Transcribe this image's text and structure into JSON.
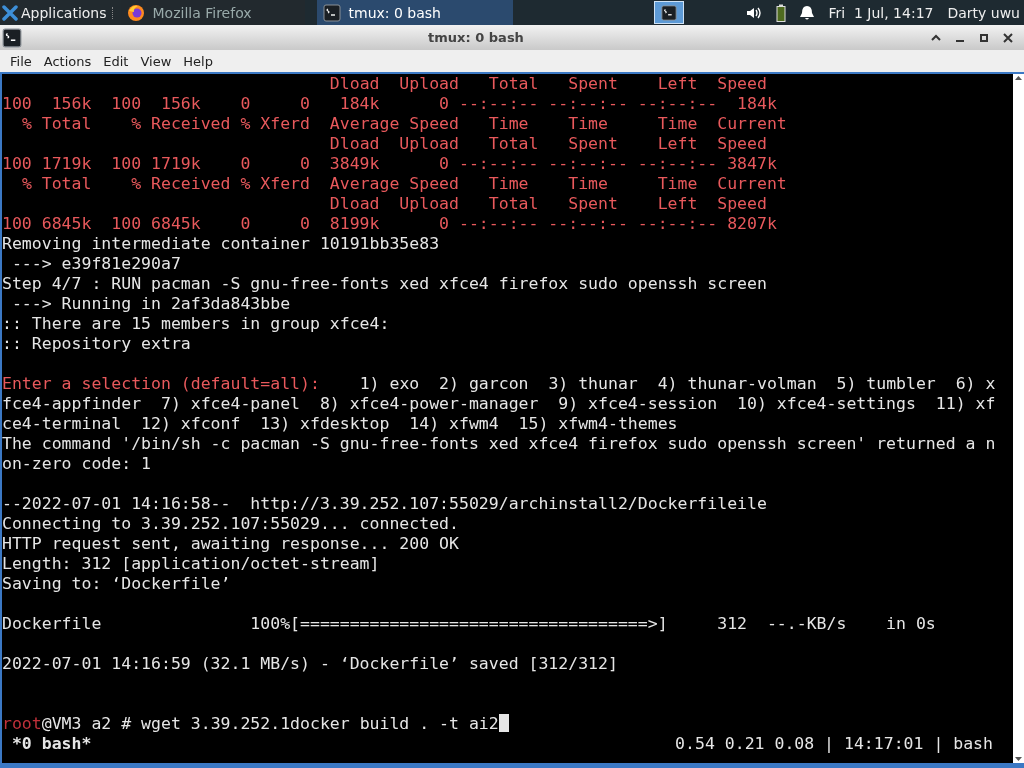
{
  "panel": {
    "apps_label": "Applications",
    "tasks": [
      {
        "label": "Mozilla Firefox",
        "selected": false
      },
      {
        "label": "tmux: 0 bash",
        "selected": true
      }
    ],
    "clock": "Fri  1 Jul, 14:17",
    "user": "Darty uwu"
  },
  "window": {
    "title": "tmux: 0 bash"
  },
  "menu": [
    "File",
    "Actions",
    "Edit",
    "View",
    "Help"
  ],
  "terminal": {
    "lines": [
      {
        "spans": [
          {
            "text": "                                 Dload  Upload   Total   Spent    Left  Speed",
            "color": "#e8595c"
          }
        ]
      },
      {
        "spans": [
          {
            "text": "100  156k  100  156k    0     0   184k      0 --:--:-- --:--:-- --:--:--  184k",
            "color": "#e8595c"
          }
        ]
      },
      {
        "spans": [
          {
            "text": "  % Total    % Received % Xferd  Average Speed   Time    Time     Time  Current",
            "color": "#e8595c"
          }
        ]
      },
      {
        "spans": [
          {
            "text": "                                 Dload  Upload   Total   Spent    Left  Speed",
            "color": "#e8595c"
          }
        ]
      },
      {
        "spans": [
          {
            "text": "100 1719k  100 1719k    0     0  3849k      0 --:--:-- --:--:-- --:--:-- 3847k",
            "color": "#e8595c"
          }
        ]
      },
      {
        "spans": [
          {
            "text": "  % Total    % Received % Xferd  Average Speed   Time    Time     Time  Current",
            "color": "#e8595c"
          }
        ]
      },
      {
        "spans": [
          {
            "text": "                                 Dload  Upload   Total   Spent    Left  Speed",
            "color": "#e8595c"
          }
        ]
      },
      {
        "spans": [
          {
            "text": "100 6845k  100 6845k    0     0  8199k      0 --:--:-- --:--:-- --:--:-- 8207k",
            "color": "#e8595c"
          }
        ]
      },
      {
        "spans": [
          {
            "text": "Removing intermediate container 10191bb35e83",
            "color": "#e6e6e6"
          }
        ]
      },
      {
        "spans": [
          {
            "text": " ---> e39f81e290a7",
            "color": "#e6e6e6"
          }
        ]
      },
      {
        "spans": [
          {
            "text": "Step 4/7 : RUN pacman -S gnu-free-fonts xed xfce4 firefox sudo openssh screen",
            "color": "#e6e6e6"
          }
        ]
      },
      {
        "spans": [
          {
            "text": " ---> Running in 2af3da843bbe",
            "color": "#e6e6e6"
          }
        ]
      },
      {
        "spans": [
          {
            "text": ":: There are 15 members in group xfce4:",
            "color": "#e6e6e6"
          }
        ]
      },
      {
        "spans": [
          {
            "text": ":: Repository extra",
            "color": "#e6e6e6"
          }
        ]
      },
      {
        "kind": "blank"
      },
      {
        "spans": [
          {
            "text": "Enter a selection (default=all):",
            "color": "#e8595c"
          },
          {
            "text": "    1) exo  2) garcon  3) thunar  4) thunar-volman  5) tumbler  6) x",
            "color": "#e6e6e6"
          }
        ]
      },
      {
        "spans": [
          {
            "text": "fce4-appfinder  7) xfce4-panel  8) xfce4-power-manager  9) xfce4-session  10) xfce4-settings  11) xf",
            "color": "#e6e6e6"
          }
        ]
      },
      {
        "spans": [
          {
            "text": "ce4-terminal  12) xfconf  13) xfdesktop  14) xfwm4  15) xfwm4-themes",
            "color": "#e6e6e6"
          }
        ]
      },
      {
        "spans": [
          {
            "text": "The command '/bin/sh -c pacman -S gnu-free-fonts xed xfce4 firefox sudo openssh screen' returned a n",
            "color": "#e6e6e6"
          }
        ]
      },
      {
        "spans": [
          {
            "text": "on-zero code: 1",
            "color": "#e6e6e6"
          }
        ]
      },
      {
        "kind": "blank"
      },
      {
        "spans": [
          {
            "text": "--2022-07-01 14:16:58--  http://3.39.252.107:55029/archinstall2/Dockerfileile",
            "color": "#e6e6e6"
          }
        ]
      },
      {
        "spans": [
          {
            "text": "Connecting to 3.39.252.107:55029... connected.",
            "color": "#e6e6e6"
          }
        ]
      },
      {
        "spans": [
          {
            "text": "HTTP request sent, awaiting response... 200 OK",
            "color": "#e6e6e6"
          }
        ]
      },
      {
        "spans": [
          {
            "text": "Length: 312 [application/octet-stream]",
            "color": "#e6e6e6"
          }
        ]
      },
      {
        "spans": [
          {
            "text": "Saving to: ‘Dockerfile’",
            "color": "#e6e6e6"
          }
        ]
      },
      {
        "kind": "blank"
      },
      {
        "spans": [
          {
            "text": "Dockerfile               100%[===================================>]     312  --.-KB/s    in 0s",
            "color": "#e6e6e6"
          }
        ]
      },
      {
        "kind": "blank"
      },
      {
        "spans": [
          {
            "text": "2022-07-01 14:16:59 (32.1 MB/s) - ‘Dockerfile’ saved [312/312]",
            "color": "#e6e6e6"
          }
        ]
      },
      {
        "kind": "blank"
      },
      {
        "kind": "blank"
      }
    ],
    "prompt": {
      "spans": [
        {
          "text": "root",
          "color": "#c0303a"
        },
        {
          "text": "@VM3 a2 # wget 3.39.252.1docker build . -t ai2",
          "color": "#e6e6e6"
        }
      ],
      "cursor": true
    },
    "status": {
      "left": " *0 bash*",
      "right": "0.54 0.21 0.08 | 14:17:01 | bash"
    }
  }
}
